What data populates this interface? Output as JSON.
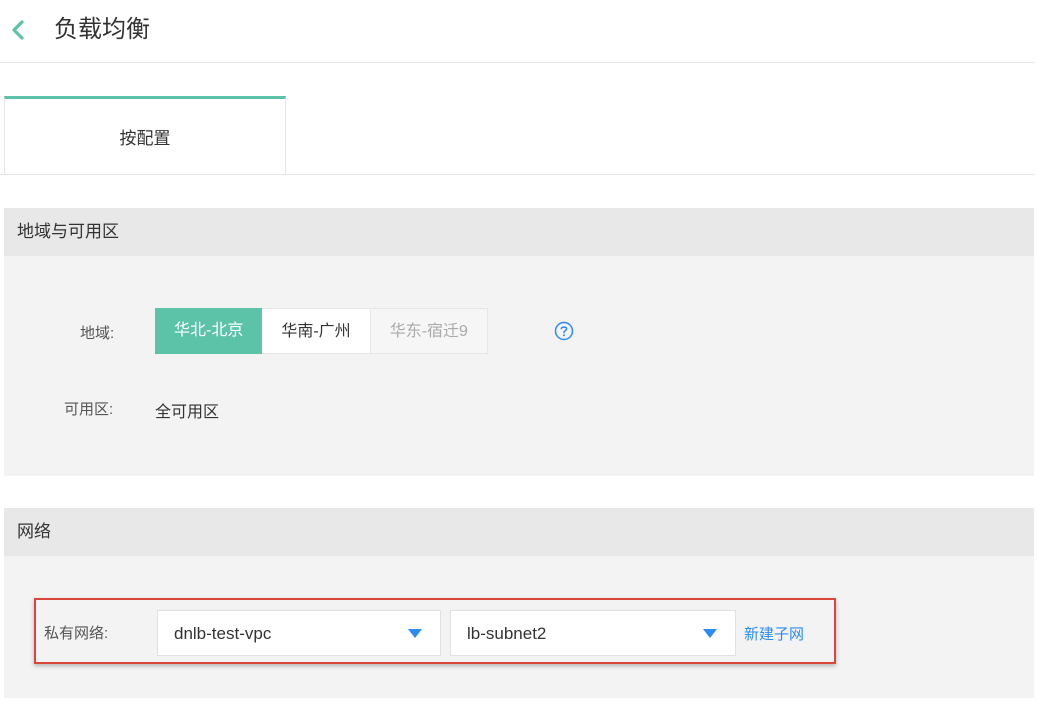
{
  "header": {
    "title": "负载均衡",
    "back_icon": "chevron-left-icon"
  },
  "tabs": [
    {
      "label": "按配置",
      "active": true
    }
  ],
  "region_section": {
    "title": "地域与可用区",
    "region_label": "地域:",
    "regions": [
      {
        "label": "华北-北京",
        "state": "selected"
      },
      {
        "label": "华南-广州",
        "state": "normal"
      },
      {
        "label": "华东-宿迁9",
        "state": "disabled"
      }
    ],
    "help_icon": "question-circle-icon",
    "zone_label": "可用区:",
    "zone_value": "全可用区"
  },
  "network_section": {
    "title": "网络",
    "vpc_label": "私有网络:",
    "vpc_value": "dnlb-test-vpc",
    "subnet_value": "lb-subnet2",
    "create_subnet_link": "新建子网"
  },
  "colors": {
    "accent": "#5cc2a8",
    "link": "#2d8cf0",
    "highlight_border": "#d9463b",
    "dropdown_arrow": "#2d8cf0"
  }
}
